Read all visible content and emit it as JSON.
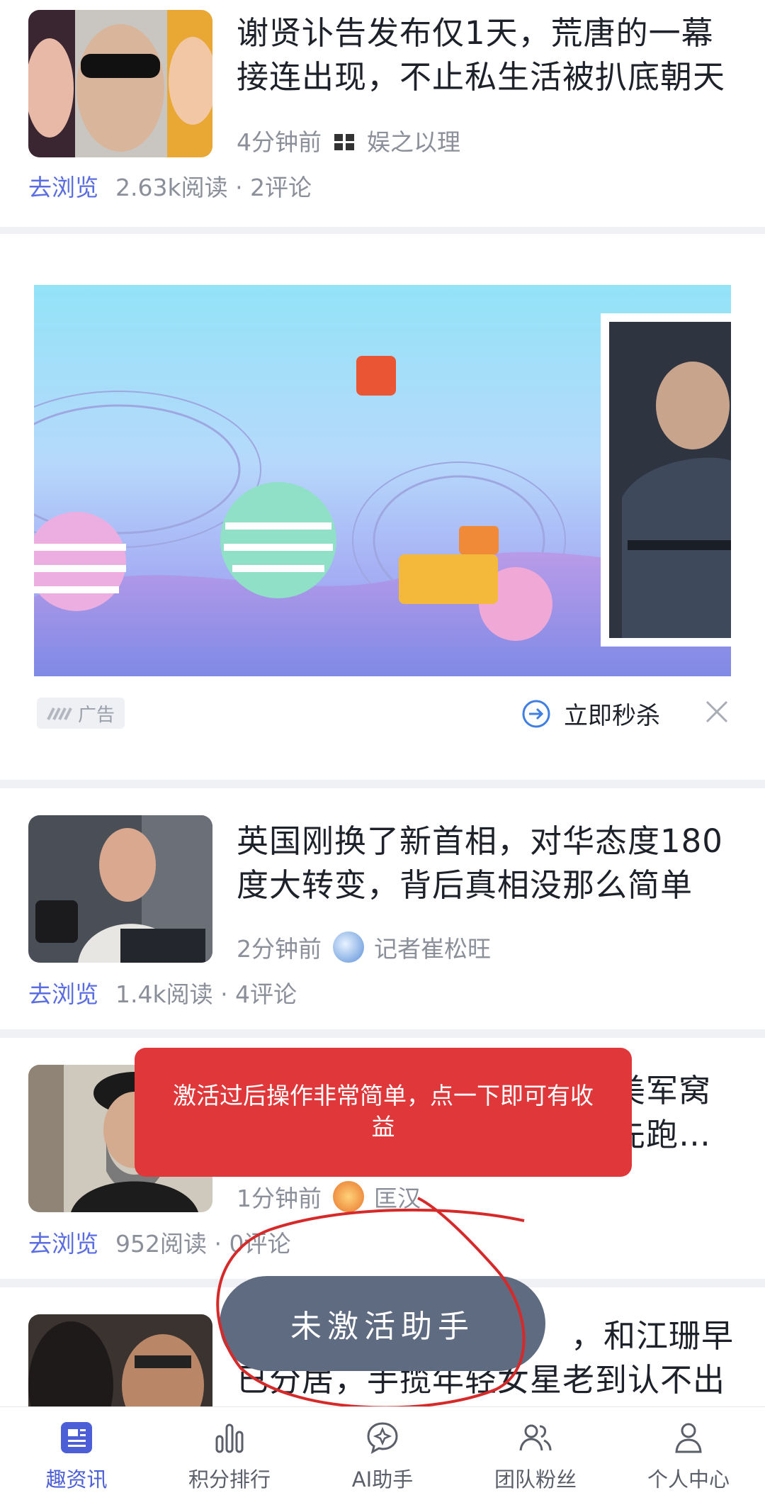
{
  "articles": [
    {
      "title": "谢贤讣告发布仅1天，荒唐的一幕接连出现，不止私生活被扒底朝天",
      "time": "4分钟前",
      "source": "娱之以理",
      "go_label": "去浏览",
      "stats": "2.63k阅读 · 2评论"
    },
    {
      "title": "英国刚换了新首相，对华态度180度大转变，背后真相没那么简单",
      "time": "2分钟前",
      "source": "记者崔松旺",
      "go_label": "去浏览",
      "stats": "1.4k阅读 · 4评论"
    },
    {
      "title_tail_line1": "美军窝",
      "title_tail_line2": "可先跑…",
      "time": "1分钟前",
      "source": "匡汉",
      "go_label": "去浏览",
      "stats": "952阅读 · 0评论"
    },
    {
      "title_line1_tail": "，和江珊早",
      "title_line2": "已分居，手揽年轻女星老到认不出"
    }
  ],
  "ad": {
    "tag": "广告",
    "cta": "立即秒杀"
  },
  "toast": {
    "text": "激活过后操作非常简单，点一下即可有收益"
  },
  "floating_button": {
    "label": "未激活助手"
  },
  "tabbar": {
    "items": [
      {
        "label": "趣资讯",
        "icon": "news-icon",
        "active": true
      },
      {
        "label": "积分排行",
        "icon": "bar-chart-icon",
        "active": false
      },
      {
        "label": "AI助手",
        "icon": "ai-chat-icon",
        "active": false
      },
      {
        "label": "团队粉丝",
        "icon": "team-icon",
        "active": false
      },
      {
        "label": "个人中心",
        "icon": "person-icon",
        "active": false
      }
    ]
  },
  "colors": {
    "accent": "#4c5fd6",
    "toast": "#e0383a",
    "float_button": "#5f6b80"
  }
}
